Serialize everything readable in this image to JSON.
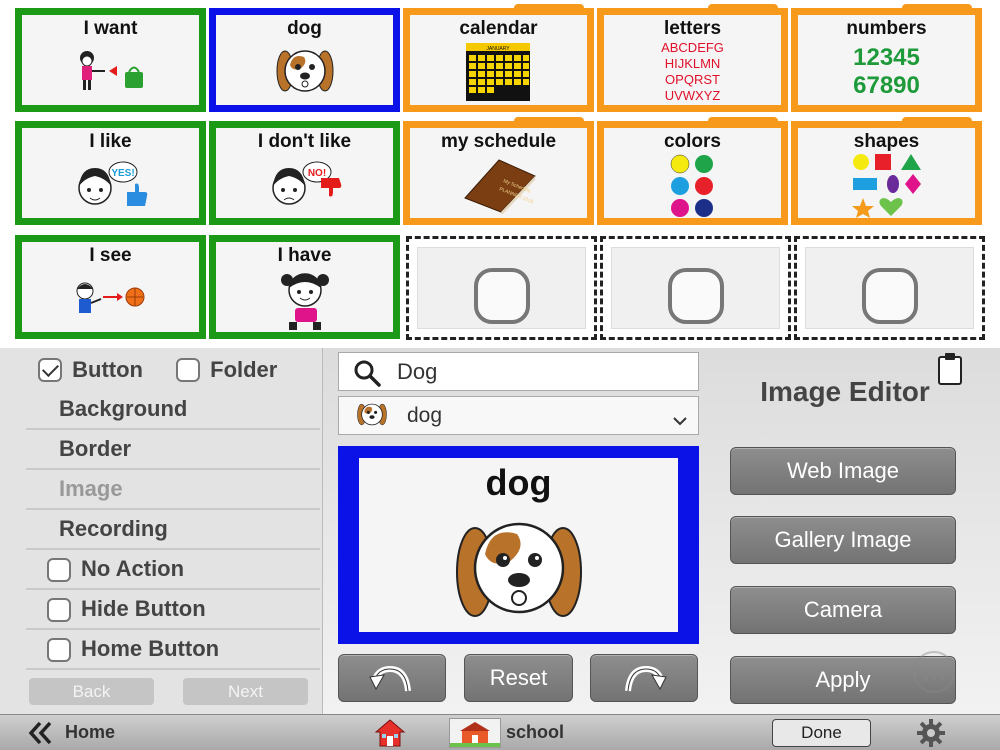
{
  "grid": {
    "tiles": [
      {
        "label": "I want",
        "border": "green",
        "kind": "button"
      },
      {
        "label": "dog",
        "border": "blue",
        "kind": "button"
      },
      {
        "label": "calendar",
        "border": "orange",
        "kind": "folder",
        "calendar_month": "JANUARY"
      },
      {
        "label": "letters",
        "border": "orange",
        "kind": "folder",
        "lines": [
          "ABCDEFG",
          "HIJKLMN",
          "OPQRST",
          "UVWXYZ"
        ]
      },
      {
        "label": "numbers",
        "border": "orange",
        "kind": "folder",
        "lines": [
          "12345",
          "67890"
        ]
      },
      {
        "label": "I like",
        "border": "green",
        "kind": "button",
        "bubble": "YES!"
      },
      {
        "label": "I don't like",
        "border": "green",
        "kind": "button",
        "bubble": "NO!"
      },
      {
        "label": "my schedule",
        "border": "orange",
        "kind": "folder",
        "book_text": [
          "My Schedule",
          "PLANNER 2018"
        ]
      },
      {
        "label": "colors",
        "border": "orange",
        "kind": "folder"
      },
      {
        "label": "shapes",
        "border": "orange",
        "kind": "folder"
      },
      {
        "label": "I see",
        "border": "green",
        "kind": "button"
      },
      {
        "label": "I have",
        "border": "green",
        "kind": "button"
      }
    ],
    "empty_slots": 3
  },
  "colors": {
    "green": "#1c9a17",
    "blue": "#0a12e8",
    "orange": "#f79a1b",
    "letters_red": "#e0102a",
    "numbers_green": "#1e9a3a"
  },
  "editor": {
    "type_button_label": "Button",
    "type_folder_label": "Folder",
    "menu": [
      "Background",
      "Border",
      "Image",
      "Recording"
    ],
    "options": [
      "No Action",
      "Hide Button",
      "Home Button"
    ],
    "back_label": "Back",
    "next_label": "Next",
    "search_value": "Dog",
    "select_value": "dog",
    "preview_label": "dog",
    "reset_label": "Reset",
    "title": "Image Editor",
    "web_image_label": "Web Image",
    "gallery_image_label": "Gallery Image",
    "camera_label": "Camera",
    "apply_label": "Apply"
  },
  "bottombar": {
    "home_label": "Home",
    "school_label": "school",
    "done_label": "Done"
  }
}
